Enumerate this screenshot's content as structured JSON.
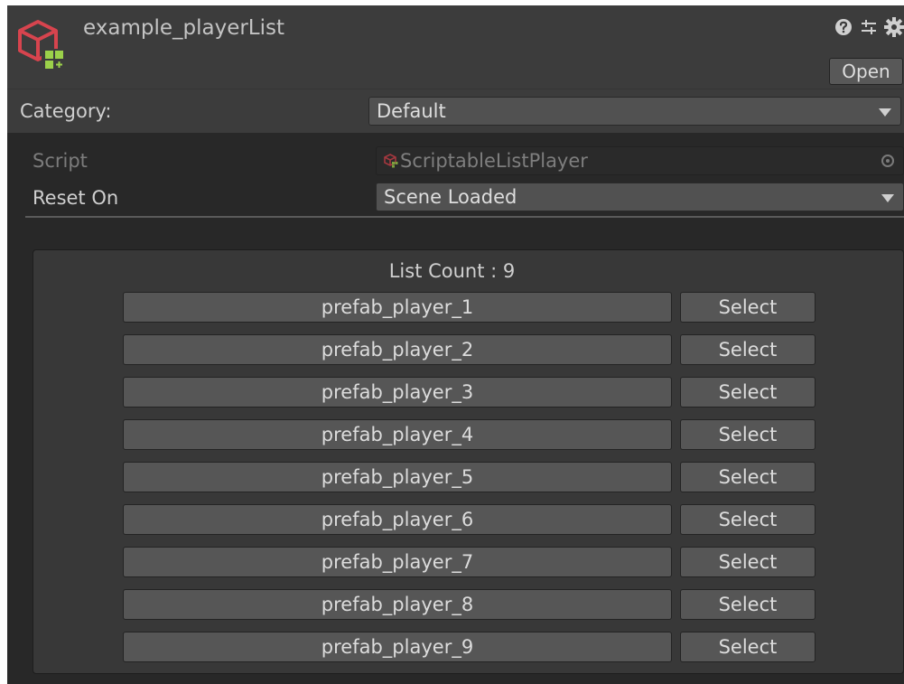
{
  "header": {
    "title": "example_playerList",
    "open_label": "Open",
    "help_icon": "help-icon",
    "presets_icon": "presets-icon",
    "settings_icon": "gear-icon"
  },
  "category": {
    "label": "Category:",
    "value": "Default"
  },
  "properties": {
    "script_label": "Script",
    "script_value": "ScriptableListPlayer",
    "reset_label": "Reset On",
    "reset_value": "Scene Loaded"
  },
  "list": {
    "count_label": "List Count : 9",
    "select_label": "Select",
    "items": [
      "prefab_player_1",
      "prefab_player_2",
      "prefab_player_3",
      "prefab_player_4",
      "prefab_player_5",
      "prefab_player_6",
      "prefab_player_7",
      "prefab_player_8",
      "prefab_player_9"
    ]
  },
  "colors": {
    "panel_bg": "#282828",
    "header_bg": "#3c3c3c",
    "button_bg": "#565656",
    "icon_red": "#d7444e",
    "icon_green": "#9bd14a"
  }
}
